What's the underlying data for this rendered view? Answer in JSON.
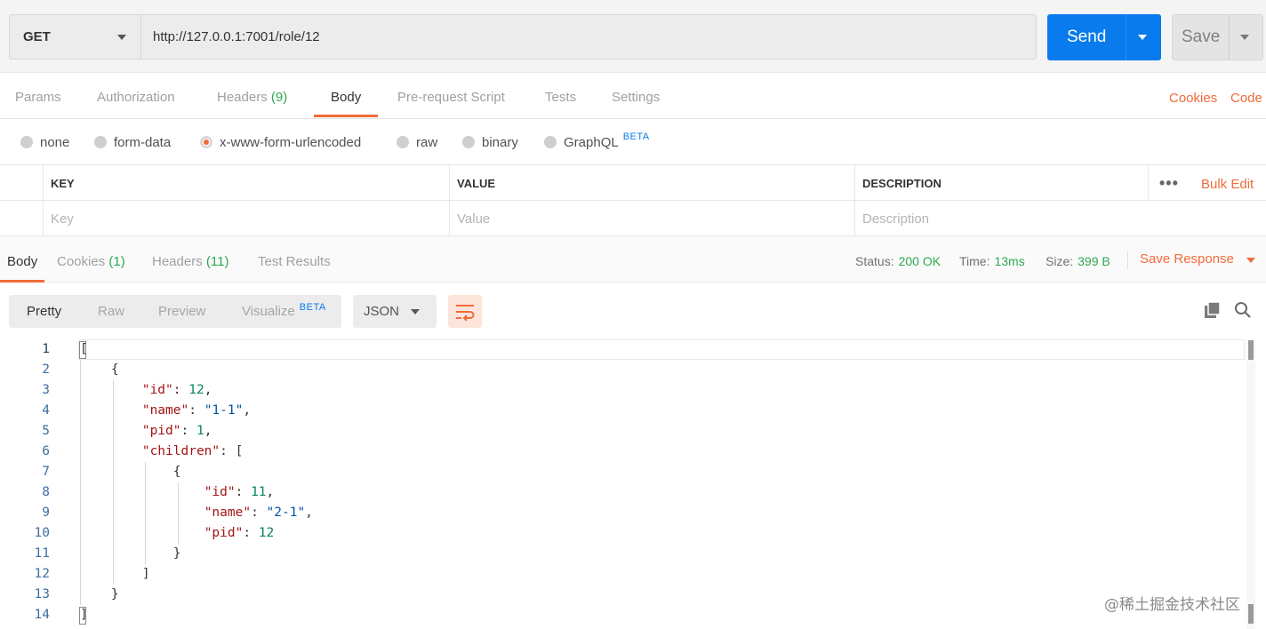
{
  "request": {
    "method": "GET",
    "url": "http://127.0.0.1:7001/role/12",
    "send_label": "Send",
    "save_label": "Save"
  },
  "request_tabs": [
    {
      "label": "Params",
      "count": ""
    },
    {
      "label": "Authorization",
      "count": ""
    },
    {
      "label": "Headers",
      "count": "(9)"
    },
    {
      "label": "Body",
      "count": ""
    },
    {
      "label": "Pre-request Script",
      "count": ""
    },
    {
      "label": "Tests",
      "count": ""
    },
    {
      "label": "Settings",
      "count": ""
    }
  ],
  "request_links": {
    "cookies": "Cookies",
    "code": "Code"
  },
  "body_types": [
    "none",
    "form-data",
    "x-www-form-urlencoded",
    "raw",
    "binary",
    "GraphQL"
  ],
  "body_type_selected": "x-www-form-urlencoded",
  "beta_label": "BETA",
  "kv_table": {
    "headers": [
      "KEY",
      "VALUE",
      "DESCRIPTION"
    ],
    "placeholders": [
      "Key",
      "Value",
      "Description"
    ],
    "more_icon": "more-horizontal-icon",
    "bulk_edit": "Bulk Edit"
  },
  "response_tabs": [
    {
      "label": "Body",
      "count": ""
    },
    {
      "label": "Cookies",
      "count": "(1)"
    },
    {
      "label": "Headers",
      "count": "(11)"
    },
    {
      "label": "Test Results",
      "count": ""
    }
  ],
  "response_status": {
    "status_label": "Status:",
    "status": "200 OK",
    "time_label": "Time:",
    "time": "13ms",
    "size_label": "Size:",
    "size": "399 B",
    "save_response": "Save Response"
  },
  "view_modes": [
    "Pretty",
    "Raw",
    "Preview",
    "Visualize"
  ],
  "format": "JSON",
  "icons": {
    "wrap": "wrap-lines-icon",
    "copy": "copy-icon",
    "search": "search-icon"
  },
  "colors": {
    "accent": "#f26b3a",
    "primary": "#097bed",
    "success": "#2fa84f"
  },
  "code_lines": [
    "1",
    "2",
    "3",
    "4",
    "5",
    "6",
    "7",
    "8",
    "9",
    "10",
    "11",
    "12",
    "13",
    "14"
  ],
  "code": [
    [
      {
        "t": "p",
        "v": "["
      }
    ],
    [
      {
        "t": "p",
        "v": "    {"
      }
    ],
    [
      {
        "t": "p",
        "v": "        "
      },
      {
        "t": "k",
        "v": "\"id\""
      },
      {
        "t": "p",
        "v": ": "
      },
      {
        "t": "n",
        "v": "12"
      },
      {
        "t": "p",
        "v": ","
      }
    ],
    [
      {
        "t": "p",
        "v": "        "
      },
      {
        "t": "k",
        "v": "\"name\""
      },
      {
        "t": "p",
        "v": ": "
      },
      {
        "t": "s",
        "v": "\"1-1\""
      },
      {
        "t": "p",
        "v": ","
      }
    ],
    [
      {
        "t": "p",
        "v": "        "
      },
      {
        "t": "k",
        "v": "\"pid\""
      },
      {
        "t": "p",
        "v": ": "
      },
      {
        "t": "n",
        "v": "1"
      },
      {
        "t": "p",
        "v": ","
      }
    ],
    [
      {
        "t": "p",
        "v": "        "
      },
      {
        "t": "k",
        "v": "\"children\""
      },
      {
        "t": "p",
        "v": ": ["
      }
    ],
    [
      {
        "t": "p",
        "v": "            {"
      }
    ],
    [
      {
        "t": "p",
        "v": "                "
      },
      {
        "t": "k",
        "v": "\"id\""
      },
      {
        "t": "p",
        "v": ": "
      },
      {
        "t": "n",
        "v": "11"
      },
      {
        "t": "p",
        "v": ","
      }
    ],
    [
      {
        "t": "p",
        "v": "                "
      },
      {
        "t": "k",
        "v": "\"name\""
      },
      {
        "t": "p",
        "v": ": "
      },
      {
        "t": "s",
        "v": "\"2-1\""
      },
      {
        "t": "p",
        "v": ","
      }
    ],
    [
      {
        "t": "p",
        "v": "                "
      },
      {
        "t": "k",
        "v": "\"pid\""
      },
      {
        "t": "p",
        "v": ": "
      },
      {
        "t": "n",
        "v": "12"
      }
    ],
    [
      {
        "t": "p",
        "v": "            }"
      }
    ],
    [
      {
        "t": "p",
        "v": "        ]"
      }
    ],
    [
      {
        "t": "p",
        "v": "    }"
      }
    ],
    [
      {
        "t": "p",
        "v": "]"
      }
    ]
  ],
  "watermark": "@稀土掘金技术社区"
}
